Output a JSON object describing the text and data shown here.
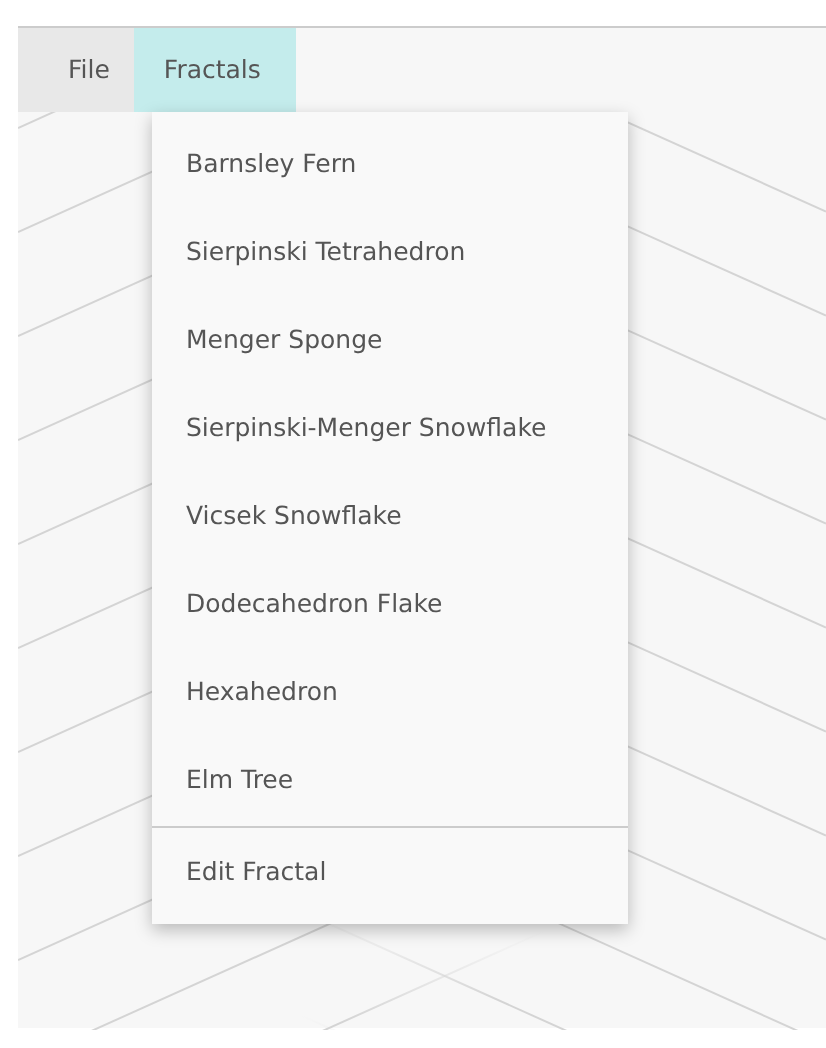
{
  "menubar": [
    {
      "label": "File",
      "selected": false
    },
    {
      "label": "Fractals",
      "selected": true
    }
  ],
  "menu": {
    "items": [
      {
        "kind": "item",
        "label": "Barnsley Fern"
      },
      {
        "kind": "item",
        "label": "Sierpinski Tetrahedron"
      },
      {
        "kind": "item",
        "label": "Menger Sponge"
      },
      {
        "kind": "item",
        "label": "Sierpinski-Menger Snowflake"
      },
      {
        "kind": "item",
        "label": "Vicsek Snowflake"
      },
      {
        "kind": "item",
        "label": "Dodecahedron Flake"
      },
      {
        "kind": "item",
        "label": "Hexahedron"
      },
      {
        "kind": "item",
        "label": "Elm Tree"
      },
      {
        "kind": "divider"
      },
      {
        "kind": "item",
        "label": "Edit Fractal"
      }
    ]
  }
}
